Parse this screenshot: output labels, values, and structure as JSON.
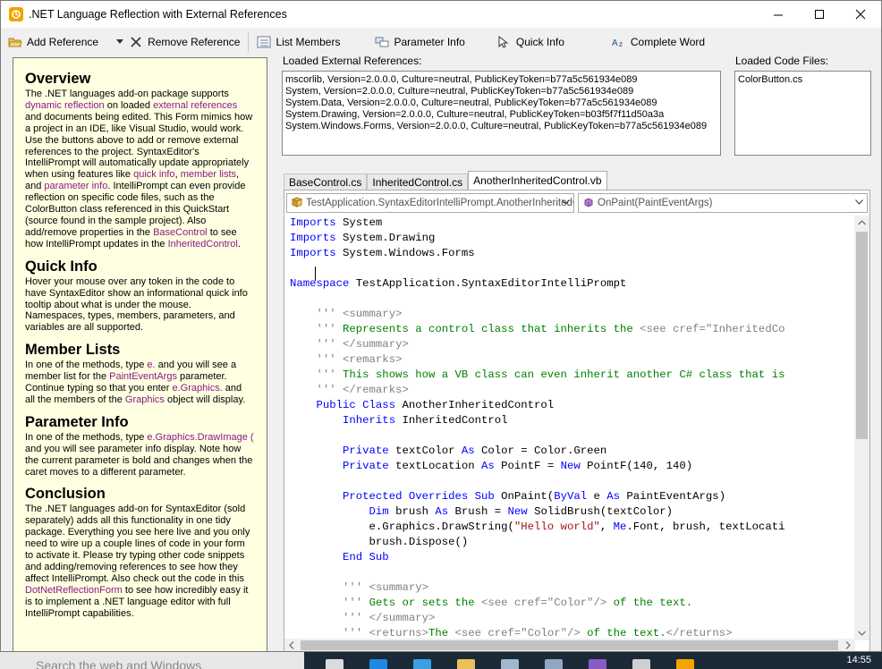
{
  "window": {
    "title": ".NET Language Reflection with External References"
  },
  "toolbar": {
    "add_reference": "Add Reference",
    "remove_reference": "Remove Reference",
    "list_members": "List Members",
    "parameter_info": "Parameter Info",
    "quick_info": "Quick Info",
    "complete_word": "Complete Word"
  },
  "help": {
    "overview": {
      "title": "Overview",
      "t1": "The .NET languages add-on package supports ",
      "l1": "dynamic reflection",
      "t2": " on loaded ",
      "l2": "external references",
      "t3": " and documents being edited.  This Form mimics how a project in an IDE, like Visual Studio, would work.  Use the buttons above to add or remove external references to the project.  SyntaxEditor's IntelliPrompt will automatically update appropriately when using features like ",
      "l3": "quick info",
      "t4": ", ",
      "l4": "member lists",
      "t5": ", and ",
      "l5": "parameter info",
      "t6": ".  IntelliPrompt can even provide reflection on specific code files, such as the ColorButton class referenced in this QuickStart (source found in the sample project).  Also add/remove properties in the ",
      "l6": "BaseControl",
      "t7": " to see how IntelliPrompt updates in the ",
      "l7": "InheritedControl",
      "t8": "."
    },
    "quickinfo": {
      "title": "Quick Info",
      "text": "Hover your mouse over any token in the code to have SyntaxEditor show an informational quick info tooltip about what is under the mouse. Namespaces, types, members, parameters, and variables are all supported."
    },
    "memberlists": {
      "title": "Member Lists",
      "t1": "In one of the methods, type ",
      "l1": "e.",
      "t2": " and you will see a member list for the ",
      "l2": "PaintEventArgs",
      "t3": " parameter.  Continue typing so that you enter ",
      "l3": "e.Graphics.",
      "t4": " and all the members of the ",
      "l4": "Graphics",
      "t5": " object will display."
    },
    "paraminfo": {
      "title": "Parameter Info",
      "t1": "In one of the methods, type ",
      "l1": "e.Graphics.DrawImage (",
      "t2": " and you will see parameter info display.  Note how the current parameter is bold and changes when the caret moves to a different parameter."
    },
    "conclusion": {
      "title": "Conclusion",
      "t1": "The .NET languages add-on for SyntaxEditor (sold separately) adds all this functionality in one tidy package.  Everything you see here live and you only need to wire up a couple lines of code in your form to activate it.  Please try typing other code snippets and adding/removing references to see how they affect IntelliPrompt.  Also check out the code in this ",
      "l1": "DotNetReflectionForm",
      "t2": " to see how incredibly easy it is to implement a .NET language editor with full IntelliPrompt capabilities."
    }
  },
  "references": {
    "label": "Loaded External References:",
    "items": [
      "mscorlib, Version=2.0.0.0, Culture=neutral, PublicKeyToken=b77a5c561934e089",
      "System, Version=2.0.0.0, Culture=neutral, PublicKeyToken=b77a5c561934e089",
      "System.Data, Version=2.0.0.0, Culture=neutral, PublicKeyToken=b77a5c561934e089",
      "System.Drawing, Version=2.0.0.0, Culture=neutral, PublicKeyToken=b03f5f7f11d50a3a",
      "System.Windows.Forms, Version=2.0.0.0, Culture=neutral, PublicKeyToken=b77a5c561934e089"
    ]
  },
  "codefiles": {
    "label": "Loaded Code Files:",
    "items": [
      "ColorButton.cs"
    ]
  },
  "tabs": [
    "BaseControl.cs",
    "InheritedControl.cs",
    "AnotherInheritedControl.vb"
  ],
  "editor": {
    "type_combo": "TestApplication.SyntaxEditorIntelliPrompt.AnotherInheritedC",
    "member_combo": "OnPaint(PaintEventArgs)",
    "code": [
      [
        [
          "k",
          "Imports"
        ],
        [
          "",
          "System"
        ]
      ],
      [
        [
          "k",
          "Imports"
        ],
        [
          "",
          "System.Drawing"
        ]
      ],
      [
        [
          "k",
          "Imports"
        ],
        [
          "",
          "System.Windows.Forms"
        ]
      ],
      [],
      [
        [
          "k",
          "Namespace"
        ],
        [
          "",
          "TestApplication.SyntaxEditorIntelliPrompt"
        ]
      ],
      [],
      [
        [
          "x",
          "    '''"
        ],
        [
          "x",
          " <summary>"
        ]
      ],
      [
        [
          "x",
          "    '''"
        ],
        [
          "c",
          " Represents a control class that inherits the "
        ],
        [
          "x",
          "<see cref=\"InheritedCo"
        ]
      ],
      [
        [
          "x",
          "    '''"
        ],
        [
          "x",
          " </summary>"
        ]
      ],
      [
        [
          "x",
          "    '''"
        ],
        [
          "x",
          " <remarks>"
        ]
      ],
      [
        [
          "x",
          "    '''"
        ],
        [
          "c",
          " This shows how a VB class can even inherit another C# class that is"
        ]
      ],
      [
        [
          "x",
          "    '''"
        ],
        [
          "x",
          " </remarks>"
        ]
      ],
      [
        [
          "k",
          "    Public Class"
        ],
        [
          "",
          "AnotherInheritedControl"
        ]
      ],
      [
        [
          "k",
          "        Inherits"
        ],
        [
          "",
          "InheritedControl"
        ]
      ],
      [],
      [
        [
          "k",
          "        Private"
        ],
        [
          "",
          "textColor"
        ],
        [
          "k",
          "As"
        ],
        [
          "",
          "Color = Color.Green"
        ]
      ],
      [
        [
          "k",
          "        Private"
        ],
        [
          "",
          "textLocation"
        ],
        [
          "k",
          "As"
        ],
        [
          "",
          "PointF ="
        ],
        [
          "k",
          "New"
        ],
        [
          "",
          "PointF(140, 140)"
        ]
      ],
      [],
      [
        [
          "k",
          "        Protected Overrides Sub"
        ],
        [
          "",
          "OnPaint("
        ],
        [
          "k",
          "ByVal"
        ],
        [
          "",
          "e"
        ],
        [
          "k",
          "As"
        ],
        [
          "",
          "PaintEventArgs)"
        ]
      ],
      [
        [
          "k",
          "            Dim"
        ],
        [
          "",
          "brush"
        ],
        [
          "k",
          "As"
        ],
        [
          "",
          "Brush ="
        ],
        [
          "k",
          "New"
        ],
        [
          "",
          "SolidBrush(textColor)"
        ]
      ],
      [
        [
          "",
          "            e.Graphics.DrawString("
        ],
        [
          "s",
          "\"Hello world\""
        ],
        [
          "",
          ","
        ],
        [
          "k",
          "Me"
        ],
        [
          "",
          ".Font, brush, textLocati"
        ]
      ],
      [
        [
          "",
          "            brush.Dispose()"
        ]
      ],
      [
        [
          "k",
          "        End Sub"
        ]
      ],
      [],
      [
        [
          "x",
          "        '''"
        ],
        [
          "x",
          " <summary>"
        ]
      ],
      [
        [
          "x",
          "        '''"
        ],
        [
          "c",
          " Gets or sets the "
        ],
        [
          "x",
          "<see cref=\"Color\"/>"
        ],
        [
          "c",
          " of the text."
        ]
      ],
      [
        [
          "x",
          "        '''"
        ],
        [
          "x",
          " </summary>"
        ]
      ],
      [
        [
          "x",
          "        '''"
        ],
        [
          "x",
          " <returns>"
        ],
        [
          "c",
          "The "
        ],
        [
          "x",
          "<see cref=\"Color\"/>"
        ],
        [
          "c",
          " of the text."
        ],
        [
          "x",
          "</returns>"
        ]
      ]
    ]
  },
  "taskbar": {
    "search": "Search the web and Windows",
    "time": "14:55"
  },
  "colors": {
    "keyword": "#0000ff",
    "comment": "#008000",
    "xmldoc": "#808080",
    "string": "#a31515",
    "help_bg": "#ffffe1",
    "link": "#8a1a8a"
  }
}
